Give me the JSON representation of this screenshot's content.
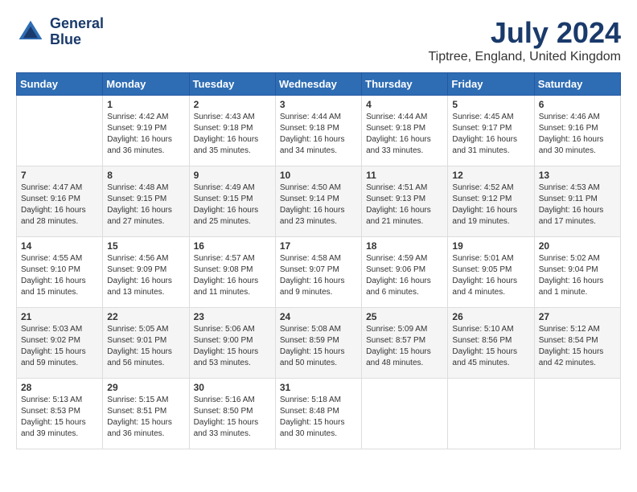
{
  "header": {
    "logo_line1": "General",
    "logo_line2": "Blue",
    "month_year": "July 2024",
    "location": "Tiptree, England, United Kingdom"
  },
  "days_of_week": [
    "Sunday",
    "Monday",
    "Tuesday",
    "Wednesday",
    "Thursday",
    "Friday",
    "Saturday"
  ],
  "weeks": [
    [
      {
        "day": "",
        "info": ""
      },
      {
        "day": "1",
        "info": "Sunrise: 4:42 AM\nSunset: 9:19 PM\nDaylight: 16 hours\nand 36 minutes."
      },
      {
        "day": "2",
        "info": "Sunrise: 4:43 AM\nSunset: 9:18 PM\nDaylight: 16 hours\nand 35 minutes."
      },
      {
        "day": "3",
        "info": "Sunrise: 4:44 AM\nSunset: 9:18 PM\nDaylight: 16 hours\nand 34 minutes."
      },
      {
        "day": "4",
        "info": "Sunrise: 4:44 AM\nSunset: 9:18 PM\nDaylight: 16 hours\nand 33 minutes."
      },
      {
        "day": "5",
        "info": "Sunrise: 4:45 AM\nSunset: 9:17 PM\nDaylight: 16 hours\nand 31 minutes."
      },
      {
        "day": "6",
        "info": "Sunrise: 4:46 AM\nSunset: 9:16 PM\nDaylight: 16 hours\nand 30 minutes."
      }
    ],
    [
      {
        "day": "7",
        "info": "Sunrise: 4:47 AM\nSunset: 9:16 PM\nDaylight: 16 hours\nand 28 minutes."
      },
      {
        "day": "8",
        "info": "Sunrise: 4:48 AM\nSunset: 9:15 PM\nDaylight: 16 hours\nand 27 minutes."
      },
      {
        "day": "9",
        "info": "Sunrise: 4:49 AM\nSunset: 9:15 PM\nDaylight: 16 hours\nand 25 minutes."
      },
      {
        "day": "10",
        "info": "Sunrise: 4:50 AM\nSunset: 9:14 PM\nDaylight: 16 hours\nand 23 minutes."
      },
      {
        "day": "11",
        "info": "Sunrise: 4:51 AM\nSunset: 9:13 PM\nDaylight: 16 hours\nand 21 minutes."
      },
      {
        "day": "12",
        "info": "Sunrise: 4:52 AM\nSunset: 9:12 PM\nDaylight: 16 hours\nand 19 minutes."
      },
      {
        "day": "13",
        "info": "Sunrise: 4:53 AM\nSunset: 9:11 PM\nDaylight: 16 hours\nand 17 minutes."
      }
    ],
    [
      {
        "day": "14",
        "info": "Sunrise: 4:55 AM\nSunset: 9:10 PM\nDaylight: 16 hours\nand 15 minutes."
      },
      {
        "day": "15",
        "info": "Sunrise: 4:56 AM\nSunset: 9:09 PM\nDaylight: 16 hours\nand 13 minutes."
      },
      {
        "day": "16",
        "info": "Sunrise: 4:57 AM\nSunset: 9:08 PM\nDaylight: 16 hours\nand 11 minutes."
      },
      {
        "day": "17",
        "info": "Sunrise: 4:58 AM\nSunset: 9:07 PM\nDaylight: 16 hours\nand 9 minutes."
      },
      {
        "day": "18",
        "info": "Sunrise: 4:59 AM\nSunset: 9:06 PM\nDaylight: 16 hours\nand 6 minutes."
      },
      {
        "day": "19",
        "info": "Sunrise: 5:01 AM\nSunset: 9:05 PM\nDaylight: 16 hours\nand 4 minutes."
      },
      {
        "day": "20",
        "info": "Sunrise: 5:02 AM\nSunset: 9:04 PM\nDaylight: 16 hours\nand 1 minute."
      }
    ],
    [
      {
        "day": "21",
        "info": "Sunrise: 5:03 AM\nSunset: 9:02 PM\nDaylight: 15 hours\nand 59 minutes."
      },
      {
        "day": "22",
        "info": "Sunrise: 5:05 AM\nSunset: 9:01 PM\nDaylight: 15 hours\nand 56 minutes."
      },
      {
        "day": "23",
        "info": "Sunrise: 5:06 AM\nSunset: 9:00 PM\nDaylight: 15 hours\nand 53 minutes."
      },
      {
        "day": "24",
        "info": "Sunrise: 5:08 AM\nSunset: 8:59 PM\nDaylight: 15 hours\nand 50 minutes."
      },
      {
        "day": "25",
        "info": "Sunrise: 5:09 AM\nSunset: 8:57 PM\nDaylight: 15 hours\nand 48 minutes."
      },
      {
        "day": "26",
        "info": "Sunrise: 5:10 AM\nSunset: 8:56 PM\nDaylight: 15 hours\nand 45 minutes."
      },
      {
        "day": "27",
        "info": "Sunrise: 5:12 AM\nSunset: 8:54 PM\nDaylight: 15 hours\nand 42 minutes."
      }
    ],
    [
      {
        "day": "28",
        "info": "Sunrise: 5:13 AM\nSunset: 8:53 PM\nDaylight: 15 hours\nand 39 minutes."
      },
      {
        "day": "29",
        "info": "Sunrise: 5:15 AM\nSunset: 8:51 PM\nDaylight: 15 hours\nand 36 minutes."
      },
      {
        "day": "30",
        "info": "Sunrise: 5:16 AM\nSunset: 8:50 PM\nDaylight: 15 hours\nand 33 minutes."
      },
      {
        "day": "31",
        "info": "Sunrise: 5:18 AM\nSunset: 8:48 PM\nDaylight: 15 hours\nand 30 minutes."
      },
      {
        "day": "",
        "info": ""
      },
      {
        "day": "",
        "info": ""
      },
      {
        "day": "",
        "info": ""
      }
    ]
  ]
}
